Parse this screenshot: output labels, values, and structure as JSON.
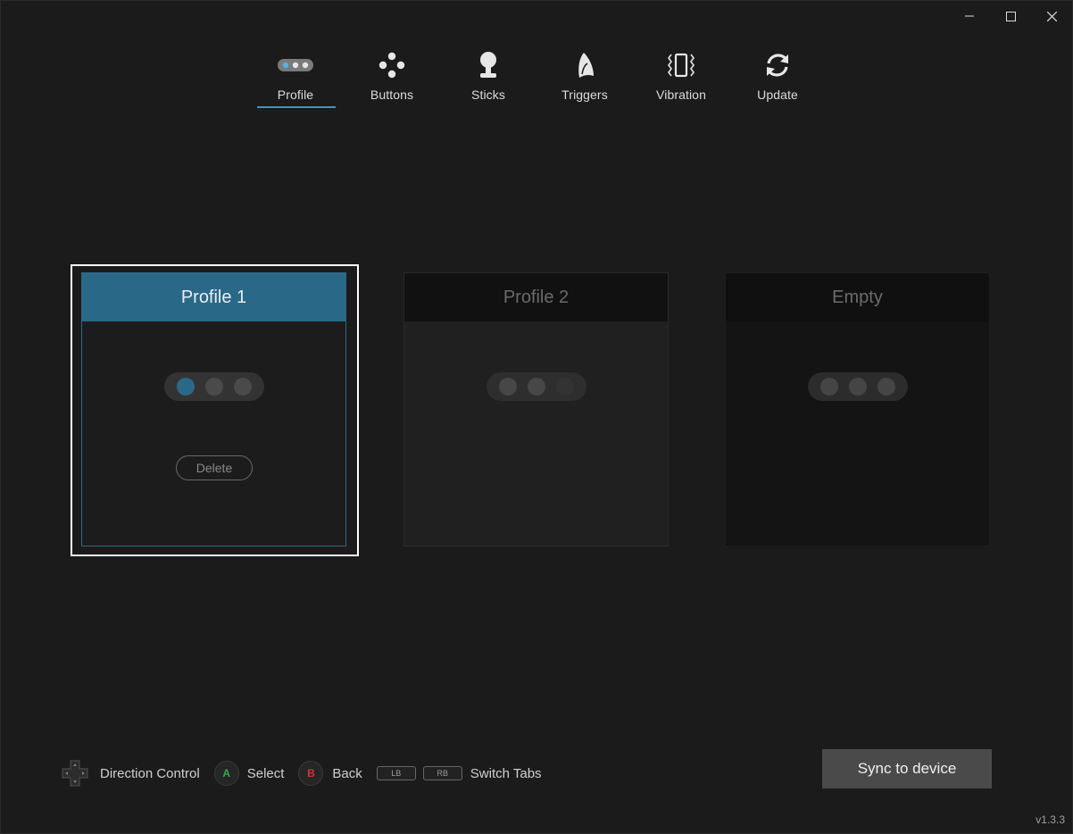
{
  "window": {
    "controls": [
      "minimize-icon",
      "maximize-icon",
      "close-icon"
    ]
  },
  "tabs": [
    {
      "label": "Profile",
      "icon": "profile-icon",
      "active": true
    },
    {
      "label": "Buttons",
      "icon": "buttons-icon",
      "active": false
    },
    {
      "label": "Sticks",
      "icon": "stick-icon",
      "active": false
    },
    {
      "label": "Triggers",
      "icon": "trigger-icon",
      "active": false
    },
    {
      "label": "Vibration",
      "icon": "vibration-icon",
      "active": false
    },
    {
      "label": "Update",
      "icon": "update-icon",
      "active": false
    }
  ],
  "profiles": [
    {
      "title": "Profile 1",
      "selected": true,
      "active_dot": 1,
      "delete_label": "Delete"
    },
    {
      "title": "Profile 2",
      "selected": false,
      "active_dot": 3
    },
    {
      "title": "Empty",
      "selected": false,
      "active_dot": null
    }
  ],
  "hints": {
    "direction": "Direction Control",
    "a_key": "A",
    "select": "Select",
    "b_key": "B",
    "back": "Back",
    "lb_key": "LB",
    "rb_key": "RB",
    "switch_tabs": "Switch Tabs"
  },
  "sync_label": "Sync to device",
  "version": "v1.3.3",
  "colors": {
    "accent": "#2a6888",
    "accent_line": "#4a90b8",
    "a_green": "#2fae4a",
    "b_red": "#d0323a"
  }
}
